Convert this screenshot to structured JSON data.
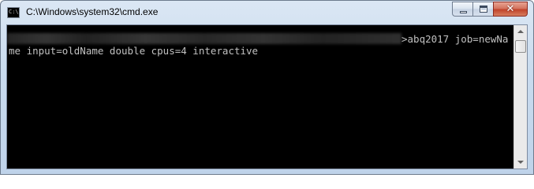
{
  "window": {
    "title": "C:\\Windows\\system32\\cmd.exe",
    "icon": "cmd-icon",
    "icon_text": "C:\\",
    "buttons": {
      "minimize": "minimize-icon",
      "maximize": "maximize-icon",
      "close": "close-icon",
      "close_glyph": "✕"
    }
  },
  "console": {
    "line1_command": ">abq2017 job=newNa",
    "line2": "me input=oldName double cpus=4 interactive",
    "background": "#000000",
    "foreground": "#c0c0c0"
  },
  "scrollbar": {
    "up": "scroll-up-arrow-icon",
    "down": "scroll-down-arrow-icon"
  }
}
